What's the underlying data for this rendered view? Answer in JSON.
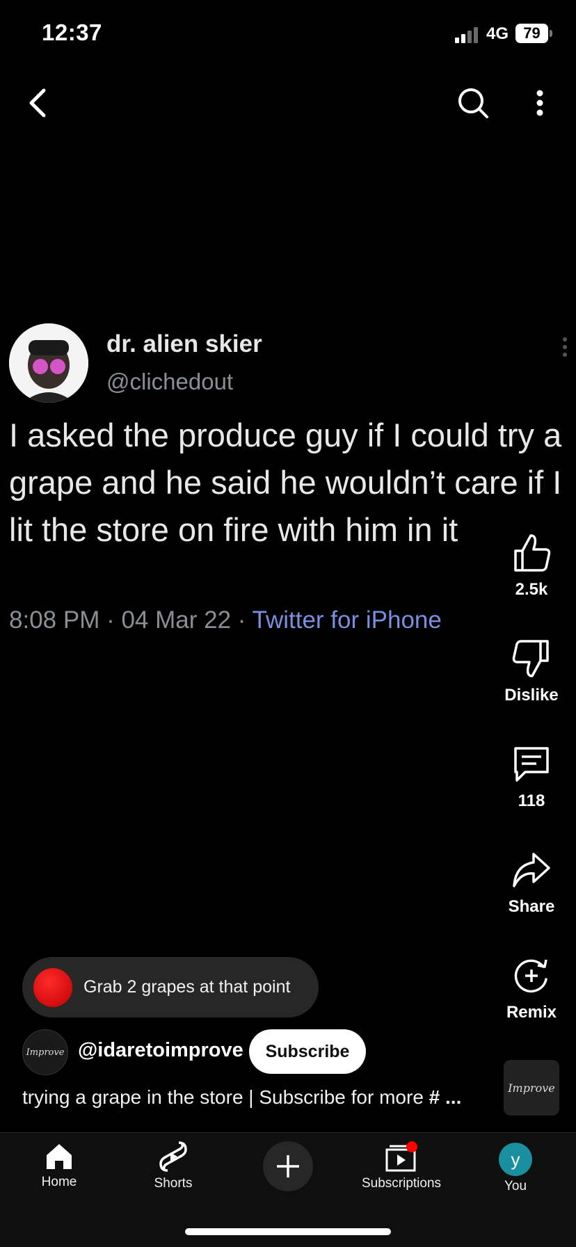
{
  "status": {
    "time": "12:37",
    "network": "4G",
    "battery": "79"
  },
  "tweet": {
    "name": "dr. alien skier",
    "handle": "@clichedout",
    "text": "I asked the produce guy if I could try a grape and he said he wouldn’t care if I lit the store on fire with him in it",
    "time": "8:08 PM · 04 Mar 22 · ",
    "source": "Twitter for iPhone"
  },
  "actions": {
    "like_count": "2.5k",
    "dislike_label": "Dislike",
    "comment_count": "118",
    "share_label": "Share",
    "remix_label": "Remix"
  },
  "chip": {
    "text": "Grab 2 grapes at that point"
  },
  "channel": {
    "handle": "@idaretoimprove",
    "avatar_text": "Improve",
    "subscribe_label": "Subscribe"
  },
  "description": {
    "text": "trying a grape in the store | Subscribe for more ",
    "hashtag": "# ..."
  },
  "nav": {
    "home": "Home",
    "shorts": "Shorts",
    "subscriptions": "Subscriptions",
    "you": "You",
    "you_initial": "y"
  },
  "colors": {
    "accent_red": "#ff0000",
    "link_blue": "#7a8fe0",
    "you_avatar": "#1a8fa0"
  }
}
